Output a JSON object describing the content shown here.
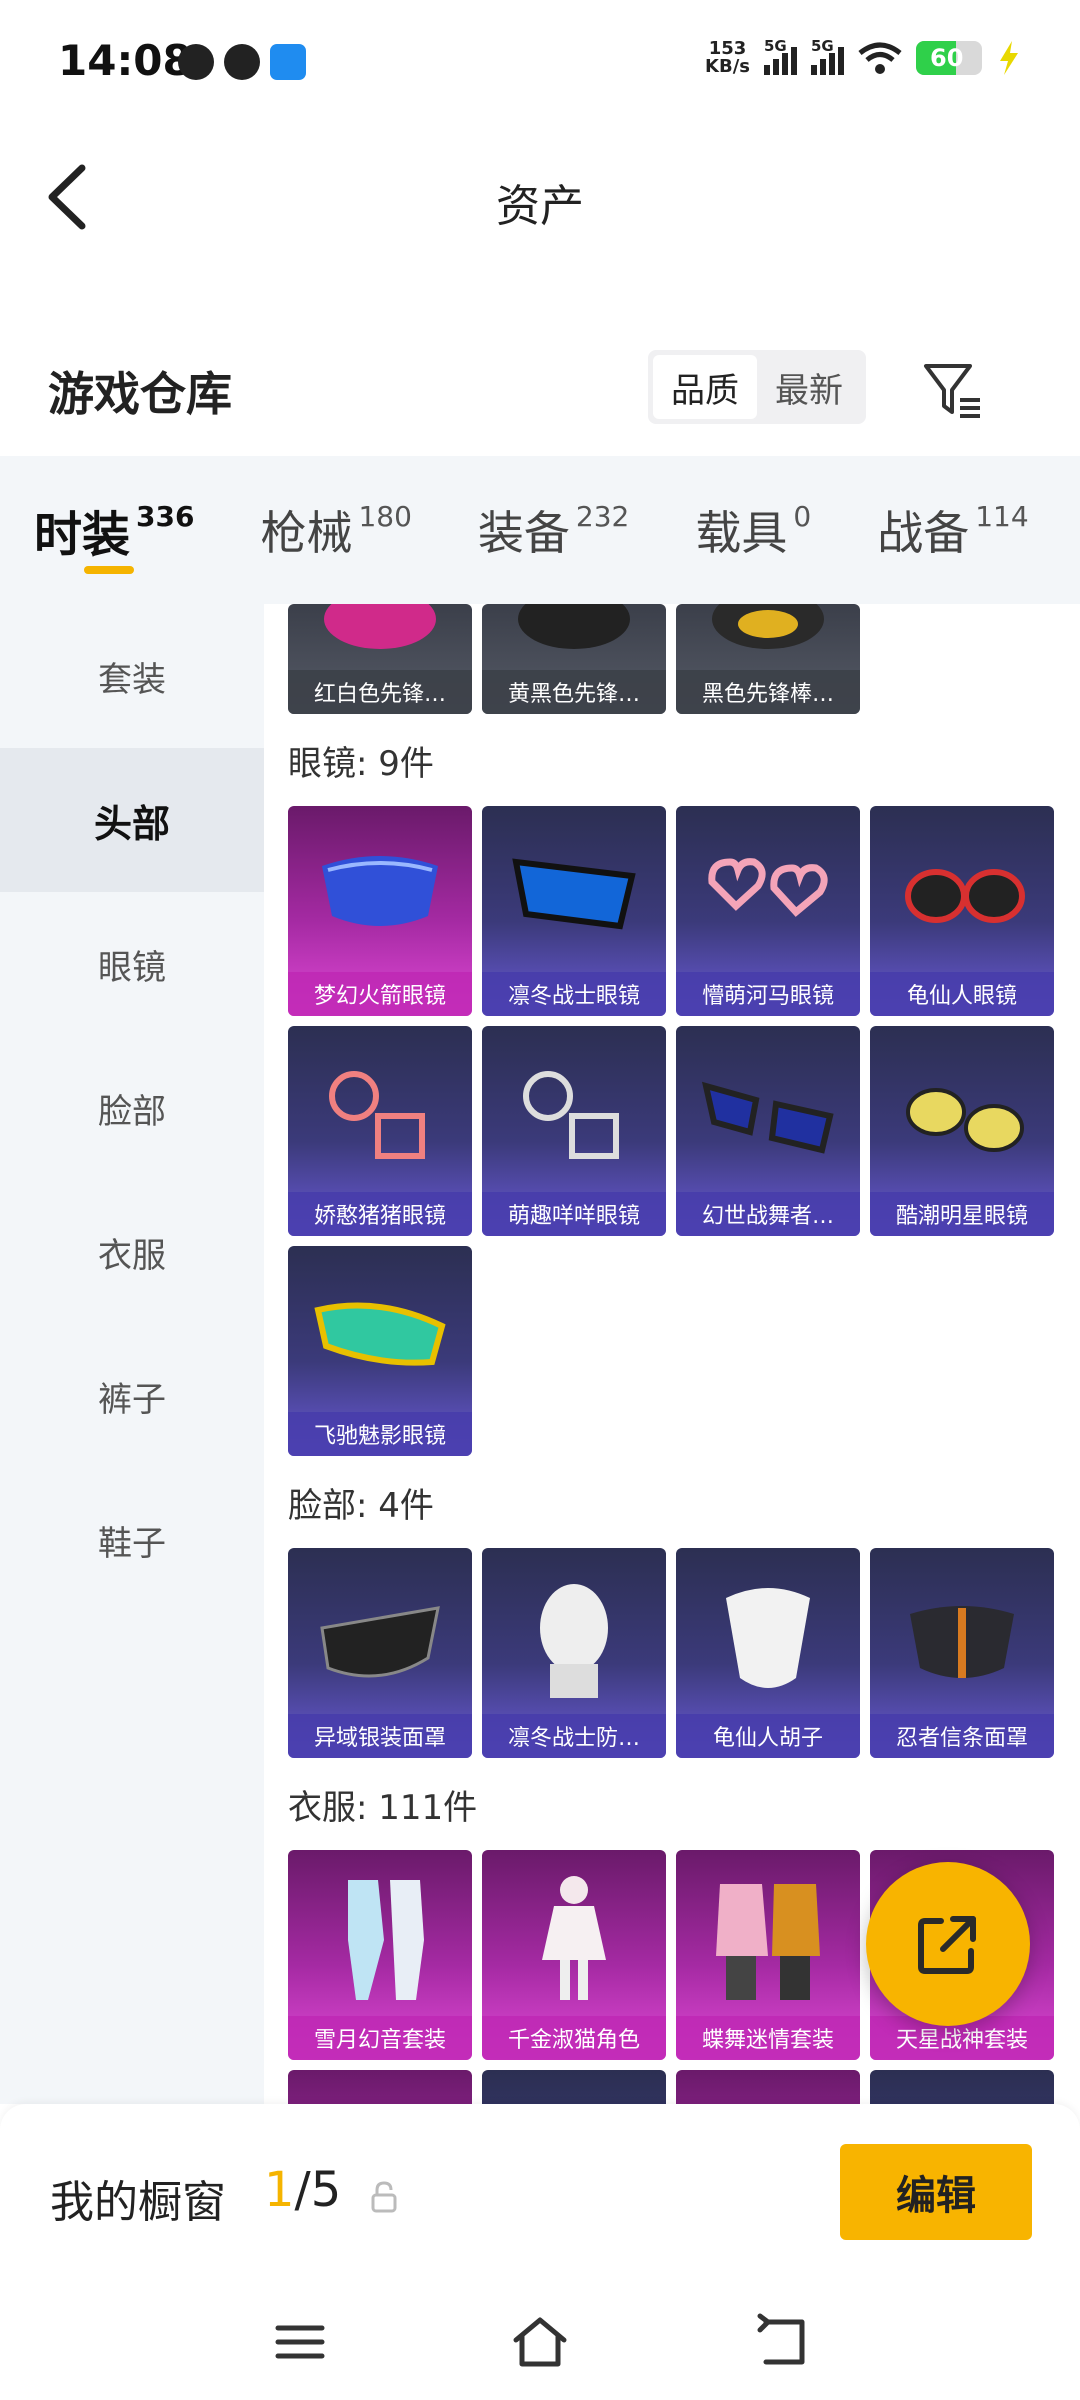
{
  "status_bar": {
    "time": "14:08",
    "net_speed_value": "153",
    "net_speed_unit": "KB/s",
    "sim1_label": "5G",
    "sim2_label": "5G",
    "battery": "60"
  },
  "header": {
    "title": "资产"
  },
  "section": {
    "title": "游戏仓库",
    "sort_options": [
      "品质",
      "最新"
    ],
    "sort_selected": "品质"
  },
  "category_tabs": [
    {
      "name": "时装",
      "count": "336",
      "active": true
    },
    {
      "name": "枪械",
      "count": "180",
      "active": false
    },
    {
      "name": "装备",
      "count": "232",
      "active": false
    },
    {
      "name": "载具",
      "count": "0",
      "active": false
    },
    {
      "name": "战备",
      "count": "114",
      "active": false
    }
  ],
  "side_nav": [
    {
      "label": "套装",
      "active": false
    },
    {
      "label": "头部",
      "active": true
    },
    {
      "label": "眼镜",
      "active": false
    },
    {
      "label": "脸部",
      "active": false
    },
    {
      "label": "衣服",
      "active": false
    },
    {
      "label": "裤子",
      "active": false
    },
    {
      "label": "鞋子",
      "active": false
    }
  ],
  "groups": {
    "head_tail": [
      "红白色先锋…",
      "黄黑色先锋…",
      "黑色先锋棒…"
    ],
    "glasses": {
      "label": "眼镜: 9件",
      "items": [
        "梦幻火箭眼镜",
        "凛冬战士眼镜",
        "懵萌河马眼镜",
        "龟仙人眼镜",
        "娇憨猪猪眼镜",
        "萌趣咩咩眼镜",
        "幻世战舞者…",
        "酷潮明星眼镜",
        "飞驰魅影眼镜"
      ]
    },
    "face": {
      "label": "脸部: 4件",
      "items": [
        "异域银装面罩",
        "凛冬战士防…",
        "龟仙人胡子",
        "忍者信条面罩"
      ]
    },
    "clothes": {
      "label": "衣服: 111件",
      "items": [
        "雪月幻音套装",
        "千金淑猫角色",
        "蝶舞迷情套装",
        "天星战神套装"
      ]
    }
  },
  "showcase": {
    "label": "我的橱窗",
    "current": "1",
    "total": "/5",
    "edit_label": "编辑"
  },
  "colors": {
    "accent": "#f8b400",
    "item_purple": "#4a3fb0",
    "item_pink": "#c02ab8"
  }
}
